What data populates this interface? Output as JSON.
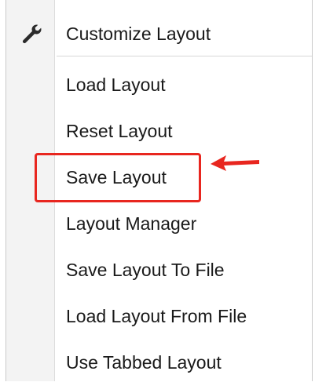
{
  "menu": {
    "header_item": {
      "label": "Customize Layout",
      "icon": "wrench-icon"
    },
    "items": [
      {
        "label": "Load Layout"
      },
      {
        "label": "Reset Layout"
      },
      {
        "label": "Save Layout"
      },
      {
        "label": "Layout Manager"
      },
      {
        "label": "Save Layout To File"
      },
      {
        "label": "Load Layout From File"
      },
      {
        "label": "Use Tabbed Layout"
      }
    ]
  },
  "annotation": {
    "highlighted_item": "Save Layout",
    "highlight_color": "#e8261f"
  }
}
